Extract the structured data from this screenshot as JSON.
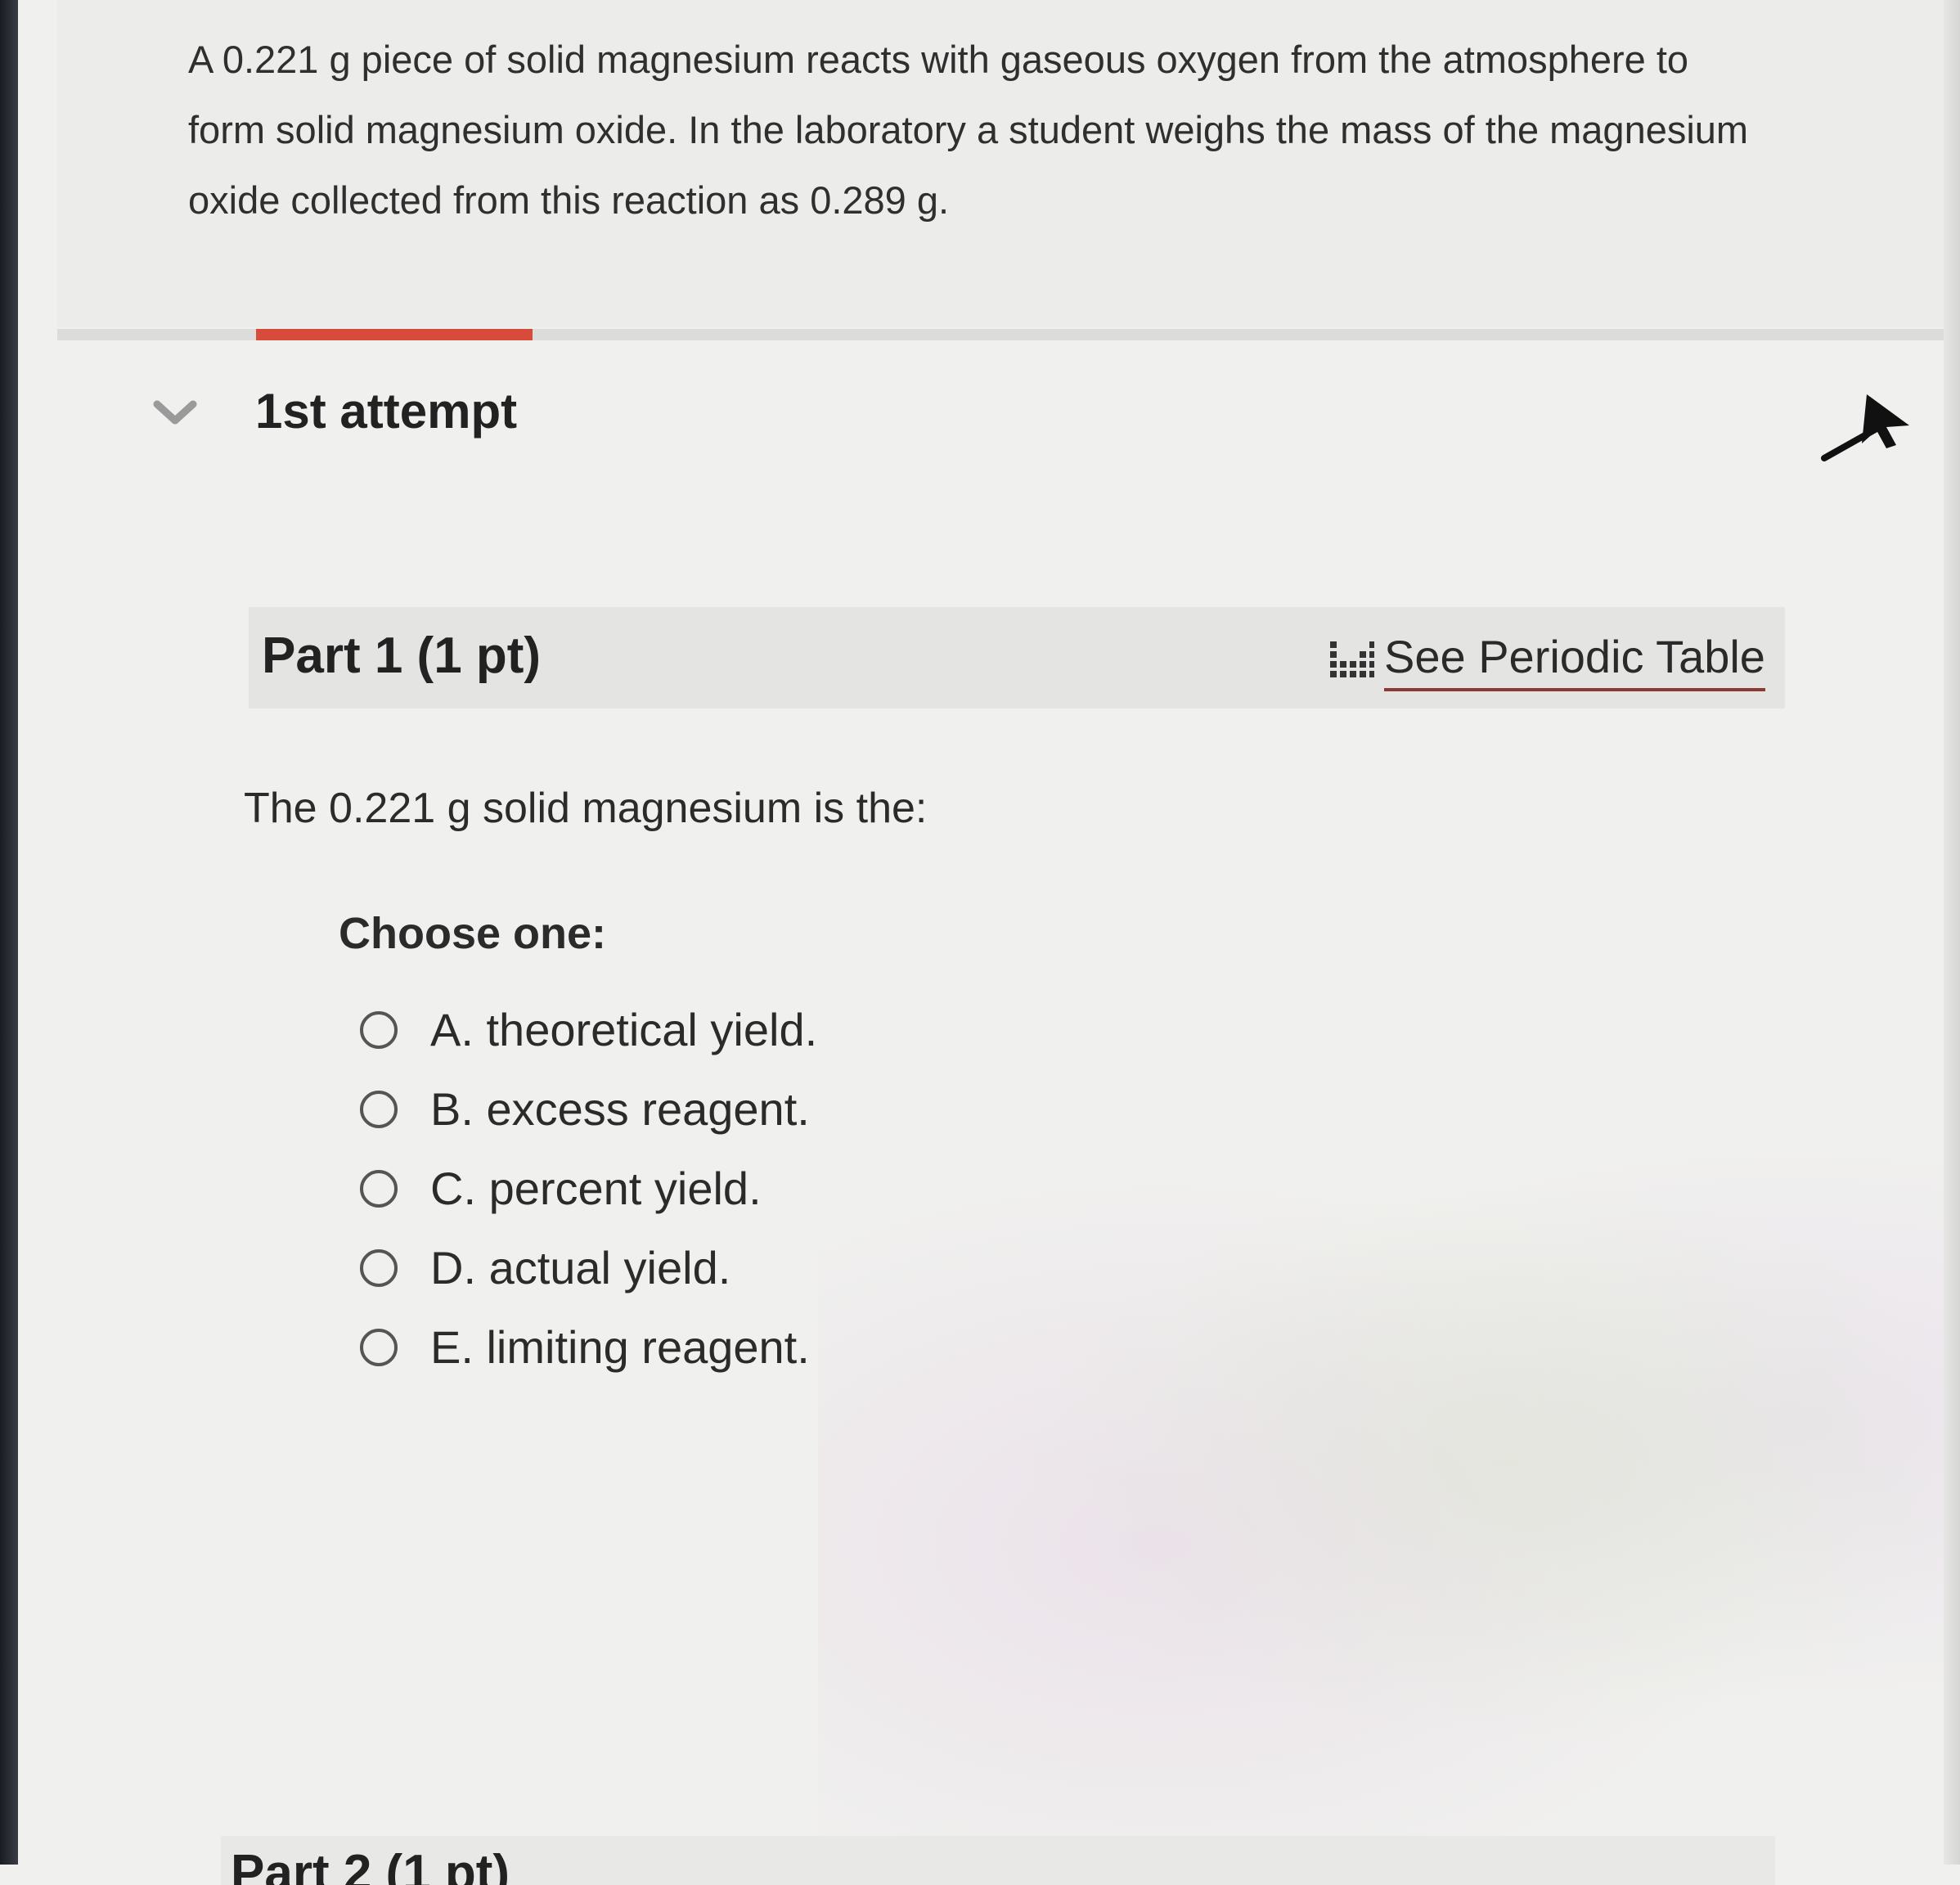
{
  "problem": {
    "line1": "A 0.221 g piece of solid magnesium reacts with gaseous oxygen from the atmosphere to",
    "line2": "form solid magnesium oxide.  In the laboratory a student weighs the mass of the magnesium",
    "line3": "oxide collected from this reaction as 0.289 g."
  },
  "attempt": {
    "title": "1st attempt"
  },
  "part": {
    "title": "Part 1 (1 pt)",
    "periodic_link": "See Periodic Table",
    "question": "The 0.221 g solid magnesium is the:",
    "choose_label": "Choose one:",
    "options": [
      {
        "letter": "A.",
        "text": "theoretical yield."
      },
      {
        "letter": "B.",
        "text": "excess reagent."
      },
      {
        "letter": "C.",
        "text": "percent yield."
      },
      {
        "letter": "D.",
        "text": "actual yield."
      },
      {
        "letter": "E.",
        "text": "limiting reagent."
      }
    ]
  },
  "next_part": {
    "title": "Part 2 (1 pt)"
  },
  "colors": {
    "accent": "#d84a3a",
    "link_underline": "#8a3a30",
    "background": "#f0f0ee"
  },
  "icons": {
    "collapse": "chevron-down-icon",
    "pin": "pin-icon",
    "periodic_table": "periodic-table-icon"
  }
}
